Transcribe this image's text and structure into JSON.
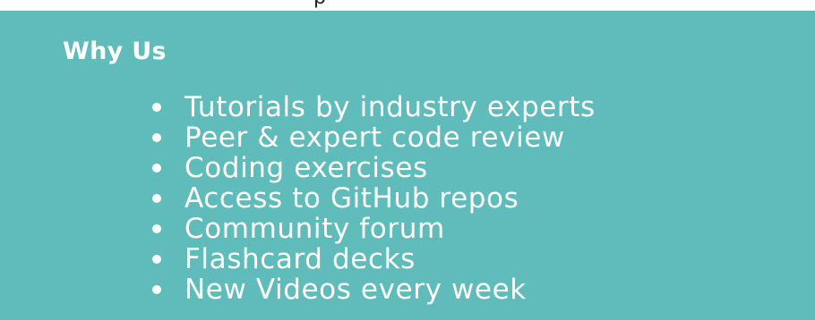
{
  "top_fragment": "p",
  "section": {
    "title": "Why Us",
    "items": [
      {
        "label": "Tutorials by industry experts"
      },
      {
        "label": "Peer & expert code review"
      },
      {
        "label": "Coding exercises"
      },
      {
        "label": "Access to GitHub repos"
      },
      {
        "label": "Community forum"
      },
      {
        "label": "Flashcard decks"
      },
      {
        "label": "New Videos every week"
      }
    ]
  },
  "colors": {
    "panel_background": "#5fbcba",
    "text": "#ffffff"
  }
}
